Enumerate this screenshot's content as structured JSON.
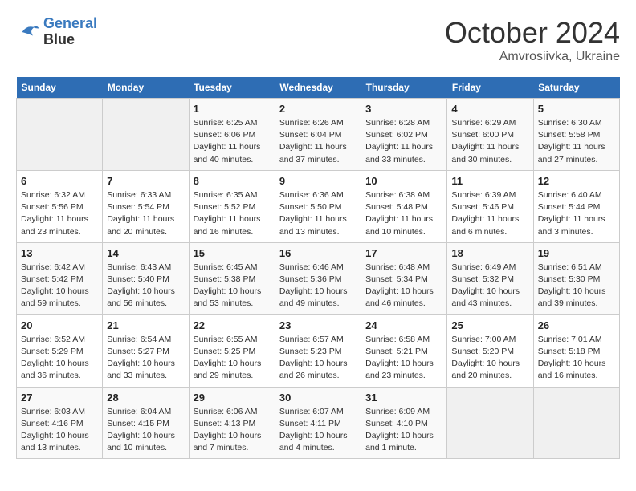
{
  "header": {
    "logo_line1": "General",
    "logo_line2": "Blue",
    "month": "October 2024",
    "location": "Amvrosiivka, Ukraine"
  },
  "weekdays": [
    "Sunday",
    "Monday",
    "Tuesday",
    "Wednesday",
    "Thursday",
    "Friday",
    "Saturday"
  ],
  "weeks": [
    [
      {
        "day": "",
        "empty": true
      },
      {
        "day": "",
        "empty": true
      },
      {
        "day": "1",
        "sunrise": "6:25 AM",
        "sunset": "6:06 PM",
        "daylight": "11 hours and 40 minutes."
      },
      {
        "day": "2",
        "sunrise": "6:26 AM",
        "sunset": "6:04 PM",
        "daylight": "11 hours and 37 minutes."
      },
      {
        "day": "3",
        "sunrise": "6:28 AM",
        "sunset": "6:02 PM",
        "daylight": "11 hours and 33 minutes."
      },
      {
        "day": "4",
        "sunrise": "6:29 AM",
        "sunset": "6:00 PM",
        "daylight": "11 hours and 30 minutes."
      },
      {
        "day": "5",
        "sunrise": "6:30 AM",
        "sunset": "5:58 PM",
        "daylight": "11 hours and 27 minutes."
      }
    ],
    [
      {
        "day": "6",
        "sunrise": "6:32 AM",
        "sunset": "5:56 PM",
        "daylight": "11 hours and 23 minutes."
      },
      {
        "day": "7",
        "sunrise": "6:33 AM",
        "sunset": "5:54 PM",
        "daylight": "11 hours and 20 minutes."
      },
      {
        "day": "8",
        "sunrise": "6:35 AM",
        "sunset": "5:52 PM",
        "daylight": "11 hours and 16 minutes."
      },
      {
        "day": "9",
        "sunrise": "6:36 AM",
        "sunset": "5:50 PM",
        "daylight": "11 hours and 13 minutes."
      },
      {
        "day": "10",
        "sunrise": "6:38 AM",
        "sunset": "5:48 PM",
        "daylight": "11 hours and 10 minutes."
      },
      {
        "day": "11",
        "sunrise": "6:39 AM",
        "sunset": "5:46 PM",
        "daylight": "11 hours and 6 minutes."
      },
      {
        "day": "12",
        "sunrise": "6:40 AM",
        "sunset": "5:44 PM",
        "daylight": "11 hours and 3 minutes."
      }
    ],
    [
      {
        "day": "13",
        "sunrise": "6:42 AM",
        "sunset": "5:42 PM",
        "daylight": "10 hours and 59 minutes."
      },
      {
        "day": "14",
        "sunrise": "6:43 AM",
        "sunset": "5:40 PM",
        "daylight": "10 hours and 56 minutes."
      },
      {
        "day": "15",
        "sunrise": "6:45 AM",
        "sunset": "5:38 PM",
        "daylight": "10 hours and 53 minutes."
      },
      {
        "day": "16",
        "sunrise": "6:46 AM",
        "sunset": "5:36 PM",
        "daylight": "10 hours and 49 minutes."
      },
      {
        "day": "17",
        "sunrise": "6:48 AM",
        "sunset": "5:34 PM",
        "daylight": "10 hours and 46 minutes."
      },
      {
        "day": "18",
        "sunrise": "6:49 AM",
        "sunset": "5:32 PM",
        "daylight": "10 hours and 43 minutes."
      },
      {
        "day": "19",
        "sunrise": "6:51 AM",
        "sunset": "5:30 PM",
        "daylight": "10 hours and 39 minutes."
      }
    ],
    [
      {
        "day": "20",
        "sunrise": "6:52 AM",
        "sunset": "5:29 PM",
        "daylight": "10 hours and 36 minutes."
      },
      {
        "day": "21",
        "sunrise": "6:54 AM",
        "sunset": "5:27 PM",
        "daylight": "10 hours and 33 minutes."
      },
      {
        "day": "22",
        "sunrise": "6:55 AM",
        "sunset": "5:25 PM",
        "daylight": "10 hours and 29 minutes."
      },
      {
        "day": "23",
        "sunrise": "6:57 AM",
        "sunset": "5:23 PM",
        "daylight": "10 hours and 26 minutes."
      },
      {
        "day": "24",
        "sunrise": "6:58 AM",
        "sunset": "5:21 PM",
        "daylight": "10 hours and 23 minutes."
      },
      {
        "day": "25",
        "sunrise": "7:00 AM",
        "sunset": "5:20 PM",
        "daylight": "10 hours and 20 minutes."
      },
      {
        "day": "26",
        "sunrise": "7:01 AM",
        "sunset": "5:18 PM",
        "daylight": "10 hours and 16 minutes."
      }
    ],
    [
      {
        "day": "27",
        "sunrise": "6:03 AM",
        "sunset": "4:16 PM",
        "daylight": "10 hours and 13 minutes."
      },
      {
        "day": "28",
        "sunrise": "6:04 AM",
        "sunset": "4:15 PM",
        "daylight": "10 hours and 10 minutes."
      },
      {
        "day": "29",
        "sunrise": "6:06 AM",
        "sunset": "4:13 PM",
        "daylight": "10 hours and 7 minutes."
      },
      {
        "day": "30",
        "sunrise": "6:07 AM",
        "sunset": "4:11 PM",
        "daylight": "10 hours and 4 minutes."
      },
      {
        "day": "31",
        "sunrise": "6:09 AM",
        "sunset": "4:10 PM",
        "daylight": "10 hours and 1 minute."
      },
      {
        "day": "",
        "empty": true
      },
      {
        "day": "",
        "empty": true
      }
    ]
  ]
}
